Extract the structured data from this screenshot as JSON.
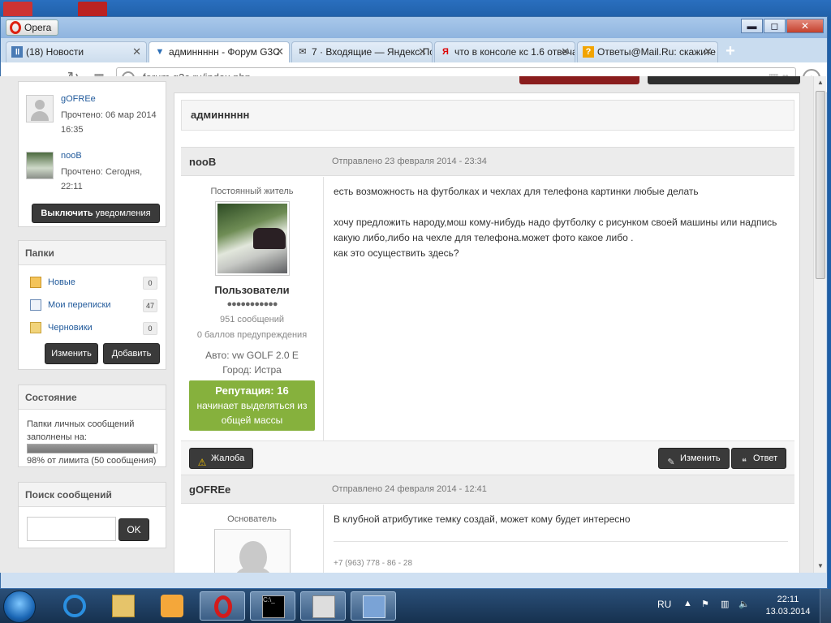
{
  "colors": {
    "accent_green": "#86b13d",
    "link_blue": "#215a9b",
    "dark_button": "#3a3a3a"
  },
  "window": {
    "app_button_label": "Opera",
    "controls": {
      "minimize": "▬",
      "maximize": "◻",
      "close": "✕"
    }
  },
  "tabs": [
    {
      "label": "(18) Новости",
      "icon": "pause-icon",
      "active": false
    },
    {
      "label": "админнннн - Форум G3C",
      "icon": "forum-icon",
      "active": true
    },
    {
      "label": "7 · Входящие — Яндекс.Почта",
      "icon": "mail-icon",
      "active": false
    },
    {
      "label": "что в консоле кс 1.6 отвечает",
      "icon": "yandex-icon",
      "active": false
    },
    {
      "label": "Ответы@Mail.Ru: скажите",
      "icon": "question-icon",
      "active": false
    }
  ],
  "new_tab_label": "+",
  "address": {
    "url": "forum.g3c.ru/index.php"
  },
  "sidebar": {
    "recipients": [
      {
        "name": "gOFREe",
        "read": "Прочтено: 06 мар 2014 16:35",
        "avatar": "person-avatar"
      },
      {
        "name": "nooB",
        "read": "Прочтено: Сегодня, 22:11",
        "avatar": "photo-avatar"
      }
    ],
    "notify_bold": "Выключить",
    "notify_rest": " уведомления",
    "folders_title": "Папки",
    "folders": [
      {
        "name": "Новые",
        "count": "0",
        "icon": "folder-new-icon"
      },
      {
        "name": "Мои переписки",
        "count": "47",
        "icon": "envelope-icon"
      },
      {
        "name": "Черновики",
        "count": "0",
        "icon": "drafts-icon"
      }
    ],
    "edit_label": "Изменить",
    "add_label": "Добавить",
    "status_title": "Состояние",
    "status_text": "Папки личных сообщений заполнены на:",
    "status_percent": 98,
    "status_limit": "98% от лимита (50 сообщения)",
    "search_title": "Поиск сообщений",
    "search_value": "",
    "search_button": "OK"
  },
  "topic": {
    "title": "админнннн"
  },
  "posts": [
    {
      "author": "nooB",
      "date": "Отправлено 23 февраля 2014 - 23:34",
      "rank": "Постоянный житель",
      "group": "Пользователи",
      "pips": "●●●●●●●●●●●",
      "posts_count": "951 сообщений",
      "warnings": "0 баллов предупреждения",
      "car_label": "Авто:",
      "car_value": "vw GOLF 2.0 E",
      "city_label": "Город:",
      "city_value": "Истра",
      "rep_title": "Репутация: 16",
      "rep_text": "начинает выделяться из общей массы",
      "body": [
        "есть возможность на футболках и чехлах для телефона картинки любые делать",
        "хочу предложить народу,мош кому-нибудь надо футболку с рисунком своей машины или надпись какую либо,либо на чехле для телефона.может фото какое либо .",
        "как это осуществить здесь?"
      ],
      "report_label": "Жалоба",
      "edit_label": "Изменить",
      "reply_label": "Ответ"
    },
    {
      "author": "gOFREe",
      "date": "Отправлено 24 февраля 2014 - 12:41",
      "rank": "Основатель",
      "body": [
        "В клубной атрибутике темку создай, может кому будет интересно"
      ],
      "signature": "+7 (963) 778 - 86 - 28"
    }
  ],
  "taskbar": {
    "apps": [
      {
        "name": "ie-icon",
        "active": false
      },
      {
        "name": "explorer-icon",
        "active": false
      },
      {
        "name": "media-player-icon",
        "active": false
      },
      {
        "name": "opera-icon",
        "active": true
      },
      {
        "name": "cmd-icon",
        "active": true
      },
      {
        "name": "counter-strike-icon",
        "active": true
      },
      {
        "name": "network-app-icon",
        "active": true
      }
    ],
    "lang": "RU",
    "time": "22:11",
    "date": "13.03.2014"
  }
}
